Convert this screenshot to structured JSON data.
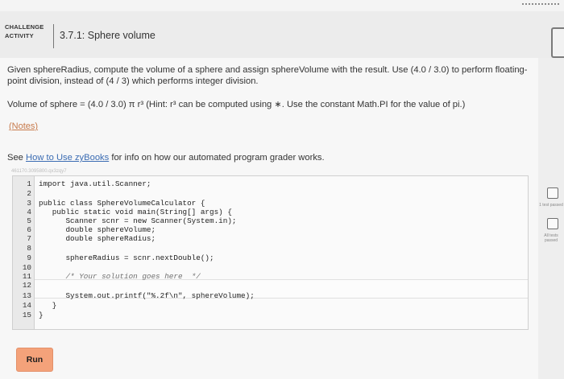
{
  "header": {
    "badge_line1": "CHALLENGE",
    "badge_line2": "ACTIVITY",
    "title": "3.7.1: Sphere volume"
  },
  "instructions": {
    "paragraph1": "Given sphereRadius, compute the volume of a sphere and assign sphereVolume with the result. Use (4.0 / 3.0) to perform floating-point division, instead of (4 / 3) which performs integer division.",
    "paragraph2": "Volume of sphere = (4.0 / 3.0) π r³ (Hint: r³ can be computed using ∗. Use the constant Math.PI for the value of pi.)",
    "notes_label": "(Notes)",
    "see_prefix": "See ",
    "see_link": "How to Use zyBooks",
    "see_suffix": " for info on how our automated program grader works.",
    "activity_id": "461170.3095800.qx3zqy7"
  },
  "editor": {
    "line_numbers": [
      "1",
      "2",
      "3",
      "4",
      "5",
      "6",
      "7",
      "8",
      "9",
      "10",
      "11",
      "12",
      "13",
      "14",
      "15"
    ],
    "lines": [
      "import java.util.Scanner;",
      "",
      "public class SphereVolumeCalculator {",
      "   public static void main(String[] args) {",
      "      Scanner scnr = new Scanner(System.in);",
      "      double sphereVolume;",
      "      double sphereRadius;",
      "",
      "      sphereRadius = scnr.nextDouble();",
      "",
      "      /* Your solution goes here  */",
      "",
      "      System.out.printf(\"%.2f\\n\", sphereVolume);",
      "   }",
      "}"
    ]
  },
  "run_button": {
    "label": "Run"
  },
  "side_panel": {
    "item1_label": "1 test passed",
    "item2_label": "All tests passed"
  }
}
